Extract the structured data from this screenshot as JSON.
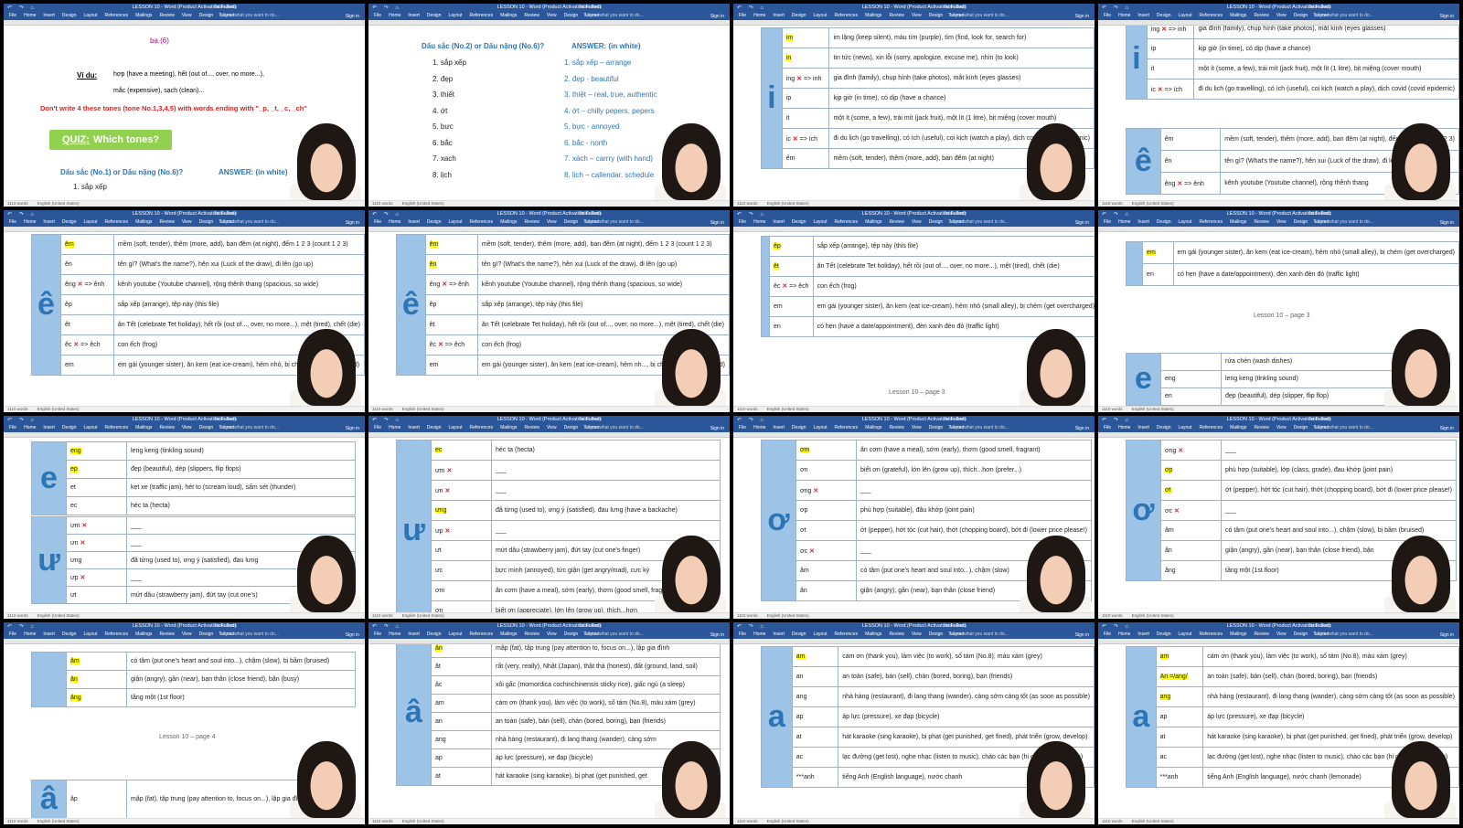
{
  "window": {
    "title": "LESSON 10 - Word (Product Activation Failed)",
    "table_tools": "Table Tools",
    "tabs": [
      "File",
      "Home",
      "Insert",
      "Design",
      "Layout",
      "References",
      "Mailings",
      "Review",
      "View",
      "Design",
      "Layout"
    ],
    "tell_me": "Tell me what you want to do...",
    "sign_in": "Sign in",
    "status_words": "1110 words",
    "status_language": "English (United States)"
  },
  "tile1": {
    "ba": "bạ (6)",
    "vi_du_label": "Ví dụ:",
    "vi_du_line1": "hợp (have a meeting), hết (out of..., over, no more...),",
    "vi_du_line2": "mắc (expensive), sạch (clean)...",
    "dont_text": "Don't write 4 these tones (tone No.1,3,4,5) with words ending with \"_p, _t, _c, _ch\"",
    "quiz_label": "QUIZ:",
    "quiz_text": "Which tones?",
    "q_head": "Dấu sắc (No.1) or Dấu nặng (No.6)?",
    "answer_head": "ANSWER: (in white)",
    "first_item": "1. sắp xếp"
  },
  "tile2": {
    "q_head": "Dấu sắc (No.2) or Dấu nặng (No.6)?",
    "answer_head": "ANSWER: (in white)",
    "questions": [
      "1. sắp xếp",
      "2. đẹp",
      "3. thiết",
      "4. ớt",
      "5. bưc",
      "6. bắc",
      "7. xach",
      "8. lịch"
    ],
    "answers": [
      "1. sắp xếp – arrange",
      "2. đẹp - beautiful",
      "3. thiệt – real, true, authentic",
      "4. ớt – chilly pepers, pepers",
      "5. bực - annoyed",
      "6. bắc - north",
      "7. xách – carrry (with hand)",
      "8. lịch – callendar, schedule"
    ]
  },
  "tile3": {
    "vowel": "i",
    "rows": [
      {
        "end": "im",
        "hl": true,
        "text": "im lặng (keep silent), màu tím (purple), tìm (find, look for, search for)"
      },
      {
        "end": "in",
        "hl": true,
        "text": "tin tức (news), xin lỗi (sorry, apologize, excuse me), nhìn (to look)"
      },
      {
        "end": "ing ✕ => inh",
        "hl": false,
        "text": "gia đình (family), chụp hình (take photos), mắt kính (eyes glasses)"
      },
      {
        "end": "ip",
        "hl": false,
        "text": "kịp giờ (in time), có dịp (have a chance)"
      },
      {
        "end": "it",
        "hl": false,
        "text": "một ít (some, a few), trái mít (jack fruit), một lít (1 litre), bịt miệng (cover mouth)"
      },
      {
        "end": "ic ✕ => ích",
        "hl": false,
        "text": "đi du lịch (go travelling), có ích (useful), coi kịch (watch a play), dịch covid (covid epidemic)"
      },
      {
        "end": "êm",
        "hl": false,
        "text": "mềm (soft, tender), thêm (more, add), ban đêm (at night)"
      }
    ]
  },
  "tile4": {
    "vowel_i": "i",
    "vowel_e": "ê",
    "rows_i": [
      {
        "end": "ing ✕ => inh",
        "text": "gia đình (family), chụp hình (take photos), mắt kính (eyes glasses)"
      },
      {
        "end": "ip",
        "text": "kịp giờ (in time), có dịp (have a chance)"
      },
      {
        "end": "it",
        "text": "một ít (some, a few), trái mít (jack fruit), một lít (1 litre), bịt miệng (cover mouth)"
      },
      {
        "end": "ic ✕ => ích",
        "text": "đi du lịch (go travelling), có ích (useful), coi kịch (watch a play), dịch covid (covid epidemic)"
      }
    ],
    "rows_e": [
      {
        "end": "êm",
        "text": "mềm (soft, tender), thêm (more, add), ban đêm (at night), đếm 1 2 3 (count 1 2 3)"
      },
      {
        "end": "ên",
        "text": "tên gì? (What's the name?), hên xui (Luck of the draw), đi lên"
      },
      {
        "end": "êng ✕ => ênh",
        "text": "kênh youtube (Youtube channel), rộng thênh thang"
      }
    ]
  },
  "tile5": {
    "vowel": "ê",
    "rows": [
      {
        "end": "êm",
        "hl": true,
        "text": "mềm (soft, tender), thêm (more, add), ban đêm (at night), đếm 1 2 3 (count 1 2 3)"
      },
      {
        "end": "ên",
        "hl": false,
        "text": "tên gì? (What's the name?), hên xui (Luck of the draw), đi lên (go up)"
      },
      {
        "end": "êng ✕ => ênh",
        "hl": false,
        "text": "kênh youtube (Youtube channel), rộng thênh thang (spacious, so wide)"
      },
      {
        "end": "êp",
        "hl": false,
        "text": "sắp xếp (arrange), tệp này (this file)"
      },
      {
        "end": "êt",
        "hl": false,
        "text": "ăn Tết (celebrate Tet holiday), hết rồi (out of..., over, no more...), mệt (tired), chết (die)"
      },
      {
        "end": "êc ✕ => êch",
        "hl": false,
        "text": "con ếch (frog)"
      },
      {
        "end": "em",
        "hl": false,
        "text": "em gái (younger sister), ăn kem (eat ice-cream), hẻm nhỏ, bị chém (get overcharged)"
      }
    ]
  },
  "tile6": {
    "vowel": "ê",
    "rows": [
      {
        "end": "êm",
        "hl": true,
        "text": "mềm (soft, tender), thêm (more, add), ban đêm (at night), đếm 1 2 3 (count 1 2 3)"
      },
      {
        "end": "ên",
        "hl": true,
        "text": "tên gì? (What's the name?), hên xui (Luck of the draw), đi lên (go up)"
      },
      {
        "end": "êng ✕ => ênh",
        "hl": false,
        "text": "kênh youtube (Youtube channel), rộng thênh thang (spacious, so wide)"
      },
      {
        "end": "êp",
        "hl": false,
        "text": "sắp xếp (arrange), tệp này (this file)"
      },
      {
        "end": "êt",
        "hl": false,
        "text": "ăn Tết (celebrate Tet holiday), hết rồi (out of..., over, no more...), mệt (tired), chết (die)"
      },
      {
        "end": "êc ✕ => êch",
        "hl": false,
        "text": "con ếch (frog)"
      },
      {
        "end": "em",
        "hl": false,
        "text": "em gái (younger sister), ăn kem (eat ice-cream), hẻm nh..., bị chém (get overcharged)"
      }
    ]
  },
  "tile7": {
    "rows": [
      {
        "end": "êp",
        "hl": true,
        "text": "sắp xếp (arrange), tệp này (this file)"
      },
      {
        "end": "êt",
        "hl": true,
        "text": "ăn Tết (celebrate Tet holiday), hết rồi (out of..., over, no more...), mệt (tired), chết (die)"
      },
      {
        "end": "êc ✕ => êch",
        "hl": false,
        "text": "con ếch (frog)"
      },
      {
        "end": "em",
        "hl": false,
        "text": "em gái (younger sister), ăn kem (eat ice-cream), hẻm nhỏ (small alley), bị chém (get overcharged)"
      },
      {
        "end": "en",
        "hl": false,
        "text": "có hẹn (have a date/appointment), đèn xanh đèn đỏ (traffic light)"
      }
    ],
    "page_label": "Lesson 10 – page 3"
  },
  "tile8": {
    "rows_top": [
      {
        "end": "em",
        "hl": true,
        "text": "em gái (younger sister), ăn kem (eat ice-cream), hẻm nhỏ (small alley), bị chém (get overcharged)"
      },
      {
        "end": "en",
        "hl": false,
        "text": "có hẹn (have a date/appointment), đèn xanh đèn đỏ (traffic light)"
      }
    ],
    "page_label": "Lesson 10 – page 3",
    "vowel": "e",
    "rows_bottom": [
      {
        "end": "",
        "text": "rửa chén (wash dishes)"
      },
      {
        "end": "eng",
        "text": "leng keng (tinkling sound)"
      },
      {
        "end": "en",
        "text": "đẹp (beautiful), dép (slipper, flip flop)"
      }
    ]
  },
  "tile9": {
    "vowel_e": "e",
    "vowel_u": "ư",
    "rows_e": [
      {
        "end": "eng",
        "hl": true,
        "text": "leng keng (tinkling sound)"
      },
      {
        "end": "ep",
        "hl": true,
        "text": "đẹp (beautiful), dép (slippers, flip flops)"
      },
      {
        "end": "et",
        "hl": false,
        "text": "kẹt xe (traffic jam), hét to (scream loud), sấm sét (thunder)"
      },
      {
        "end": "ec",
        "hl": false,
        "text": "héc ta (hecta)"
      }
    ],
    "rows_u": [
      {
        "end": "ưm ✕",
        "text": "___"
      },
      {
        "end": "ưn ✕",
        "text": "___"
      },
      {
        "end": "ưng",
        "text": "đã từng (used to), ưng ý (satisfied), đau lưng"
      },
      {
        "end": "ưp ✕",
        "text": "___"
      },
      {
        "end": "ưt",
        "text": "mứt dâu (strawberry jam), đứt tay (cut one's)"
      }
    ]
  },
  "tile10": {
    "vowel": "ư",
    "rows": [
      {
        "end": "ec",
        "hl": true,
        "text": "héc ta (hecta)"
      },
      {
        "end": "ưm ✕",
        "hl": false,
        "text": "___"
      },
      {
        "end": "ưn ✕",
        "hl": false,
        "text": "___"
      },
      {
        "end": "ưng",
        "hl": true,
        "text": "đã từng (used to), ưng ý (satisfied), đau lưng (have a backache)"
      },
      {
        "end": "ưp ✕",
        "hl": false,
        "text": "___"
      },
      {
        "end": "ưt",
        "hl": false,
        "text": "mứt dâu (strawberry jam), đứt tay (cut one's finger)"
      },
      {
        "end": "ưc",
        "hl": false,
        "text": "bực mình (annoyed), tức giận (get angry/mad), cực kỳ"
      },
      {
        "end": "ơm",
        "hl": false,
        "text": "ăn cơm (have a meal), sớm (early), thơm (good smell, fragrant)"
      },
      {
        "end": "ơn",
        "hl": false,
        "text": "biết ơn (appreciate), lớn lên (grow up), thích...hơn"
      }
    ]
  },
  "tile11": {
    "vowel": "ơ",
    "rows": [
      {
        "end": "ơm",
        "hl": true,
        "text": "ăn cơm (have a meal), sớm (early), thơm (good smell, fragrant)"
      },
      {
        "end": "ơn",
        "hl": false,
        "text": "biết ơn (grateful), lớn lên (grow up), thích...hơn (prefer...)"
      },
      {
        "end": "ơng ✕",
        "hl": false,
        "text": "___"
      },
      {
        "end": "ơp",
        "hl": false,
        "text": "phù hợp (suitable), đâu khớp (joint pain)"
      },
      {
        "end": "ơt",
        "hl": false,
        "text": "ớt (pepper), hớt tóc (cut hair), thớt (chopping board), bớt đi (lower price please!)"
      },
      {
        "end": "ơc ✕",
        "hl": false,
        "text": "___"
      },
      {
        "end": "âm",
        "hl": false,
        "text": "có tâm (put one's heart and soul into...), chậm (slow)"
      },
      {
        "end": "ân",
        "hl": false,
        "text": "giận (angry), gần (near), bạn thân (close friend)"
      }
    ]
  },
  "tile12": {
    "vowel": "ơ",
    "rows": [
      {
        "end": "ơng ✕",
        "hl": false,
        "text": "___"
      },
      {
        "end": "ơp",
        "hl": true,
        "text": "phù hợp (suitable), lớp (class, grade), đau khớp (joint pain)"
      },
      {
        "end": "ơt",
        "hl": true,
        "text": "ớt (pepper), hớt tóc (cut hair), thớt (chopping board), bớt đi (lower price please!)"
      },
      {
        "end": "ơc ✕",
        "hl": false,
        "text": "___"
      },
      {
        "end": "âm",
        "hl": false,
        "text": "có tâm (put one's heart and soul into...), chậm (slow), bị bầm (bruised)"
      },
      {
        "end": "ân",
        "hl": false,
        "text": "giận (angry), gần (near), bạn thân (close friend), bận"
      },
      {
        "end": "âng",
        "hl": false,
        "text": "tầng một (1st floor)"
      }
    ]
  },
  "tile13": {
    "rows": [
      {
        "end": "âm",
        "hl": true,
        "text": "có tâm (put one's heart and soul into...), chậm (slow), bị bầm (bruised)"
      },
      {
        "end": "ân",
        "hl": true,
        "text": "giận (angry), gần (near), bạn thân (close friend), bận (busy)"
      },
      {
        "end": "âng",
        "hl": true,
        "text": "tầng một (1st floor)"
      }
    ],
    "page_label": "Lesson 10 – page 4",
    "vowel": "â",
    "bottom_row": {
      "end": "âp",
      "text": "mập (fat), tập trung (pay attention to, focus on...), lập gia đình (get married)"
    }
  },
  "tile14": {
    "vowel_a_hat": "â",
    "vowel_a": "a",
    "rows": [
      {
        "end": "ân",
        "hl": true,
        "text": "mập (fat), tập trung (pay attention to, focus on...), lập gia đình"
      },
      {
        "end": "ât",
        "hl": false,
        "text": "rất (very, really), Nhật (Japan), thật thà (honest), đất (ground, land, soil)"
      },
      {
        "end": "âc",
        "hl": false,
        "text": "xôi gấc (momordica cochinchinensis sticky rice), giấc ngủ (a sleep)"
      },
      {
        "end": "am",
        "hl": false,
        "text": "cám ơn (thank you), làm việc (to work), số tám (No.8), màu xám (grey)"
      },
      {
        "end": "an",
        "hl": false,
        "text": "an toàn (safe), bán (sell), chán (bored, boring), bạn (friends)"
      },
      {
        "end": "ang",
        "hl": false,
        "text": "nhà hàng (restaurant), đi lang thang (wander), càng sớm"
      },
      {
        "end": "ap",
        "hl": false,
        "text": "áp lực (pressure), xe đạp (bicycle)"
      },
      {
        "end": "at",
        "hl": false,
        "text": "hát karaoke (sing karaoke), bị phạt (get punished, get"
      }
    ]
  },
  "tile15": {
    "vowel": "a",
    "rows": [
      {
        "end": "am",
        "hl": true,
        "text": "cám ơn (thank you), làm việc (to work), số tám (No.8), màu xám (grey)"
      },
      {
        "end": "an",
        "hl": false,
        "text": "an toàn (safe), bán (sell), chán (bored, boring), bạn (friends)"
      },
      {
        "end": "ang",
        "hl": false,
        "text": "nhà hàng (restaurant), đi lang thang (wander), càng sớm càng tốt (as soon as possible)"
      },
      {
        "end": "ap",
        "hl": false,
        "text": "áp lực (pressure), xe đạp (bicycle)"
      },
      {
        "end": "at",
        "hl": false,
        "text": "hát karaoke (sing karaoke), bị phạt (get punished, get fined), phát triển (grow, develop)"
      },
      {
        "end": "ac",
        "hl": false,
        "text": "lạc đường (get lost), nghe nhạc (listen to music), chào các bạn (hi guys, hi everyone)"
      },
      {
        "end": "***anh",
        "hl": false,
        "text": "tiếng Anh (English language), nước chanh"
      }
    ]
  },
  "tile16": {
    "vowel": "a",
    "rows": [
      {
        "end": "am",
        "hl": true,
        "text": "cám ơn (thank you), làm việc (to work), số tám (No.8), màu xám (grey)"
      },
      {
        "end": "An =/ang/",
        "hl": true,
        "text": "an toàn (safe), bán (sell), chán (bored, boring), bạn (friends)"
      },
      {
        "end": "ang",
        "hl": true,
        "text": "nhà hàng (restaurant), đi lang thang (wander), càng sớm càng tốt (as soon as possible)"
      },
      {
        "end": "ap",
        "hl": false,
        "text": "áp lực (pressure), xe đạp (bicycle)"
      },
      {
        "end": "at",
        "hl": false,
        "text": "hát karaoke (sing karaoke), bị phạt (get punished, get fined), phát triển (grow, develop)"
      },
      {
        "end": "ac",
        "hl": false,
        "text": "lạc đường (get lost), nghe nhạc (listen to music), chào các bạn (hi guys, hi everyone)"
      },
      {
        "end": "***anh",
        "hl": false,
        "text": "tiếng Anh (English language), nước chanh (lemonade)"
      }
    ]
  }
}
